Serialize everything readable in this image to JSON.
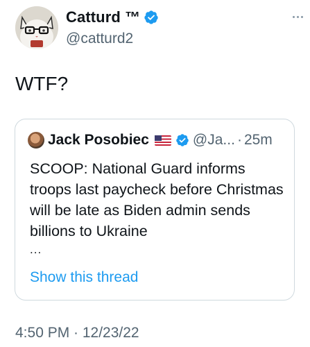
{
  "author": {
    "display_name": "Catturd ™",
    "handle": "@catturd2",
    "avatar_icon": "cat-with-glasses-avatar",
    "verified_icon": "verified-badge-icon"
  },
  "tweet": {
    "text": "WTF?",
    "timestamp": "4:50 PM · 12/23/22"
  },
  "quoted_tweet": {
    "display_name": "Jack Posobiec",
    "flag_icon": "us-flag-icon",
    "handle": "@Ja...",
    "separator": "·",
    "time": "25m",
    "text": "SCOOP: National Guard informs troops last paycheck before Christmas will be late as Biden admin sends billions to Ukraine",
    "ellipsis": "...",
    "show_thread_label": "Show this thread"
  },
  "colors": {
    "accent": "#1d9bf0",
    "secondary_text": "#536471",
    "border": "#cfd9de"
  }
}
